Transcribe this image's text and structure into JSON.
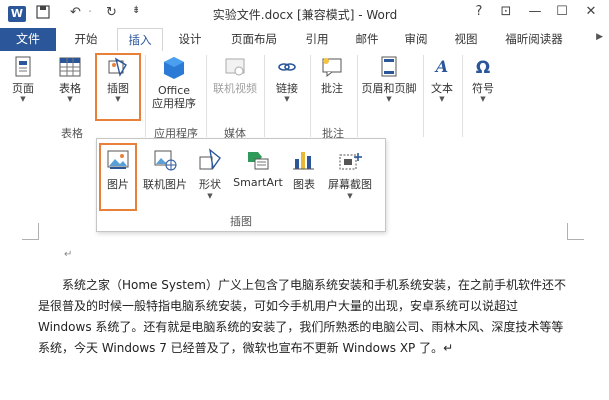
{
  "titlebar": {
    "undo": "↶",
    "separator": "·",
    "redo": "↻",
    "qa_caret": "⇟",
    "title": "实验文件.docx [兼容模式] - Word",
    "help": "?",
    "restore": "⊡",
    "minimize": "—",
    "maximize": "☐",
    "close": "✕"
  },
  "tabs": [
    "文件",
    "开始",
    "插入",
    "设计",
    "页面布局",
    "引用",
    "邮件",
    "审阅",
    "视图",
    "福昕阅读器"
  ],
  "active_tab": "插入",
  "ribbon": {
    "groups": [
      {
        "label": "表格"
      },
      {
        "label": "应用程序"
      },
      {
        "label": "媒体"
      },
      {
        "label": "批注"
      }
    ],
    "buttons": {
      "page": "页面",
      "table": "表格",
      "illustration": "插图",
      "office_apps": "Office\n应用程序",
      "online_video": "联机视频",
      "link": "链接",
      "comment": "批注",
      "header_footer": "页眉和页脚",
      "text": "文本",
      "symbol": "符号"
    }
  },
  "panel": {
    "items": [
      "图片",
      "联机图片",
      "形状",
      "SmartArt",
      "图表",
      "屏幕截图"
    ],
    "label": "插图"
  },
  "document": {
    "para_mark": "↵",
    "paragraph": "系统之家（Home System）广义上包含了电脑系统安装和手机系统安装，在之前手机软件还不是很普及的时候一般特指电脑系统安装，可如今手机用户大量的出现，安卓系统可以说超过 Windows 系统了。还有就是电脑系统的安装了，我们所熟悉的电脑公司、雨林木风、深度技术等等系统，今天 Windows 7 已经普及了，微软也宣布不更新 Windows XP 了。↵"
  },
  "colors": {
    "accent": "#2b579a",
    "highlight": "#e8803a"
  }
}
